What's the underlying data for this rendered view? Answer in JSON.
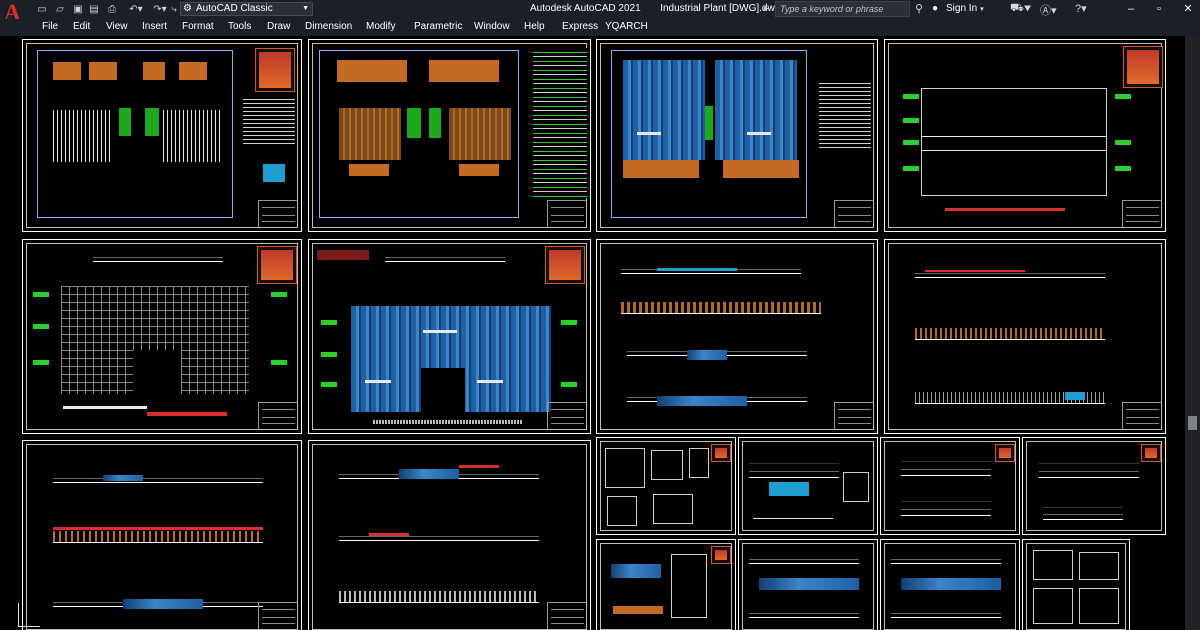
{
  "window": {
    "app_title": "Autodesk AutoCAD 2021",
    "file_title": "Industrial Plant [DWG].dwg"
  },
  "workspace": {
    "name": "AutoCAD Classic"
  },
  "search": {
    "placeholder": "Type a keyword or phrase"
  },
  "account": {
    "sign_in_label": "Sign In"
  },
  "menu": {
    "items": [
      "File",
      "Edit",
      "View",
      "Insert",
      "Format",
      "Tools",
      "Draw",
      "Dimension",
      "Modify",
      "Parametric",
      "Window",
      "Help",
      "Express",
      "YQARCH"
    ]
  },
  "quick_access": {
    "icons": [
      "new-icon",
      "open-icon",
      "save-icon",
      "save-as-icon",
      "plot-icon",
      "undo-icon",
      "redo-icon",
      "share-icon"
    ]
  },
  "colors": {
    "background": "#000000",
    "title_bar": "#1b1f27",
    "logo_red": "#e02d2d",
    "roof_blue": "#1f5fa3",
    "lawn_green": "#1ea81e",
    "title_block_red": "#d92e2e"
  }
}
